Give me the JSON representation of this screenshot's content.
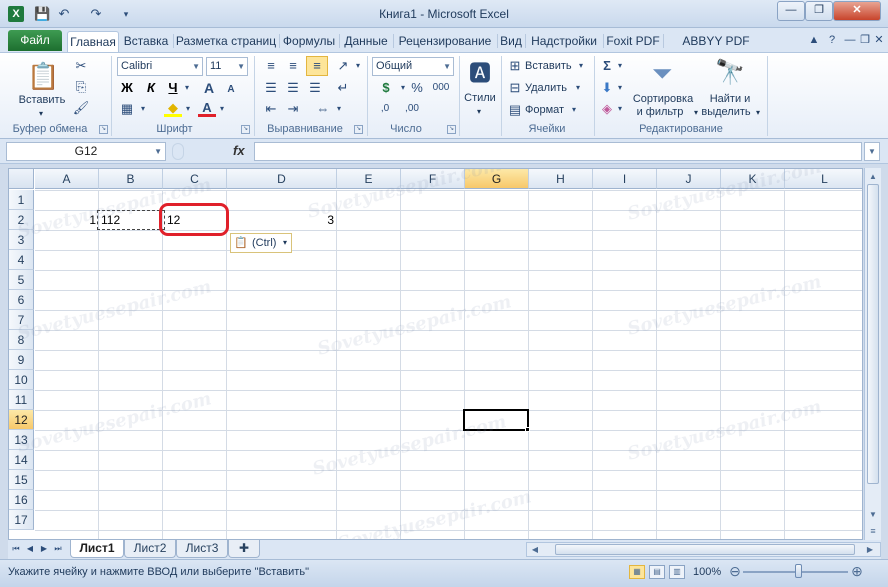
{
  "titlebar": {
    "title": "Книга1  -  Microsoft Excel",
    "minimize": "—",
    "restore": "❐",
    "close": "✕"
  },
  "qat": {
    "save_icon": "💾",
    "undo_icon": "↶",
    "redo_icon": "↷",
    "customize_icon": "▾"
  },
  "tabs": {
    "file": "Файл",
    "items": [
      "Главная",
      "Вставка",
      "Разметка страниц",
      "Формулы",
      "Данные",
      "Рецензирование",
      "Вид",
      "Надстройки",
      "Foxit PDF",
      "ABBYY PDF Transfo"
    ],
    "active_index": 0
  },
  "ribbon": {
    "clipboard": {
      "label": "Буфер обмена",
      "paste": "Вставить",
      "cut_icon": "✂",
      "copy_icon": "⎘",
      "painter_icon": "🖌"
    },
    "font": {
      "label": "Шрифт",
      "font_name": "Calibri",
      "font_size": "11",
      "bold": "Ж",
      "italic": "К",
      "underline": "Ч",
      "grow": "A",
      "shrink": "A",
      "borders_icon": "▦",
      "fill_icon": "◆",
      "font_color_icon": "A"
    },
    "alignment": {
      "label": "Выравнивание"
    },
    "number": {
      "label": "Число",
      "format": "Общий",
      "currency": "$",
      "percent": "%",
      "thousands": "000",
      "inc_decimal": ",0",
      "dec_decimal": ",00"
    },
    "styles": {
      "label": "Стили"
    },
    "cells": {
      "label": "Ячейки",
      "insert": "Вставить",
      "delete": "Удалить",
      "format": "Формат"
    },
    "editing": {
      "label": "Редактирование",
      "sum_icon": "Σ",
      "fill_icon": "⬇",
      "clear_icon": "◈",
      "sort_line1": "Сортировка",
      "sort_line2": "и фильтр",
      "find_line1": "Найти и",
      "find_line2": "выделить"
    }
  },
  "formula_bar": {
    "name_box": "G12",
    "fx": "fx",
    "formula": ""
  },
  "grid": {
    "columns": [
      "A",
      "B",
      "C",
      "D",
      "E",
      "F",
      "G",
      "H",
      "I",
      "J",
      "K",
      "L"
    ],
    "rows": [
      "1",
      "2",
      "3",
      "4",
      "5",
      "6",
      "7",
      "8",
      "9",
      "10",
      "11",
      "12",
      "13",
      "14",
      "15",
      "16",
      "17"
    ],
    "selected_col": "G",
    "selected_row": "12",
    "cells": {
      "A2": "1",
      "B2": "112",
      "C2": "12",
      "D2": "3"
    },
    "paste_options": "(Ctrl)"
  },
  "sheets": {
    "tabs": [
      "Лист1",
      "Лист2",
      "Лист3"
    ],
    "active_index": 0
  },
  "status": {
    "message": "Укажите ячейку и нажмите ВВОД или выберите \"Вставить\"",
    "zoom": "100%"
  },
  "watermark": "Sovetyuesepair.com"
}
